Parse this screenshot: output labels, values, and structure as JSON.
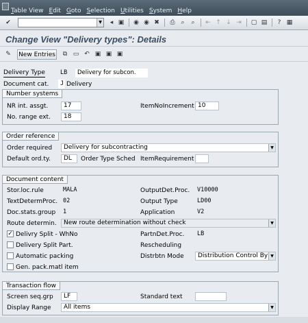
{
  "menu": [
    "Table View",
    "Edit",
    "Goto",
    "Selection",
    "Utilities",
    "System",
    "Help"
  ],
  "title": "Change View \"Delivery types\": Details",
  "app_toolbar": {
    "new_entries": "New Entries"
  },
  "header": {
    "delivery_type_label": "Delivery Type",
    "delivery_type_value": "LB",
    "delivery_type_desc": "Delivery for subcon.",
    "doc_cat_label": "Document cat.",
    "doc_cat_value": "J",
    "doc_cat_desc": "Delivery"
  },
  "number_systems": {
    "title": "Number systems",
    "nr_int_label": "NR int. assgt.",
    "nr_int_value": "17",
    "item_incr_label": "ItemNoIncrement",
    "item_incr_value": "10",
    "nr_ext_label": "No. range ext.",
    "nr_ext_value": "18"
  },
  "order_reference": {
    "title": "Order reference",
    "order_required_label": "Order required",
    "order_required_value": "Delivery for subcontracting",
    "default_ord_label": "Default ord.ty.",
    "default_ord_value": "DL",
    "order_type_sched_label": "Order Type Sched",
    "item_requirement_label": "ItemRequirement",
    "item_requirement_value": ""
  },
  "document_content": {
    "title": "Document content",
    "stor_loc_label": "Stor.loc.rule",
    "stor_loc_value": "MALA",
    "output_det_label": "OutputDet.Proc.",
    "output_det_value": "V10000",
    "text_determ_label": "TextDetermProc.",
    "text_determ_value": "02",
    "output_type_label": "Output Type",
    "output_type_value": "LD00",
    "doc_stats_label": "Doc.stats.group",
    "doc_stats_value": "1",
    "application_label": "Application",
    "application_value": "V2",
    "route_label": "Route determin.",
    "route_value": "New route determination without check",
    "delivery_split_whno_label": "Delivry Split - WhNo",
    "partn_det_label": "PartnDet.Proc.",
    "partn_det_value": "LB",
    "delivery_split_part_label": "Delivery Split Part.",
    "rescheduling_label": "Rescheduling",
    "automatic_packing_label": "Automatic packing",
    "distrbtn_mode_label": "Distrbtn Mode",
    "distrbtn_mode_value": "Distribution Control By Wa",
    "gen_pack_label": "Gen. pack.matl item"
  },
  "transaction_flow": {
    "title": "Transaction flow",
    "screen_seq_label": "Screen seq.grp",
    "screen_seq_value": "LF",
    "standard_text_label": "Standard text",
    "standard_text_value": "",
    "display_range_label": "Display Range",
    "display_range_value": "All items"
  },
  "colors": {
    "menubar": "#4a5a68",
    "background": "#e8ecf0",
    "title": "#3a4c60"
  }
}
